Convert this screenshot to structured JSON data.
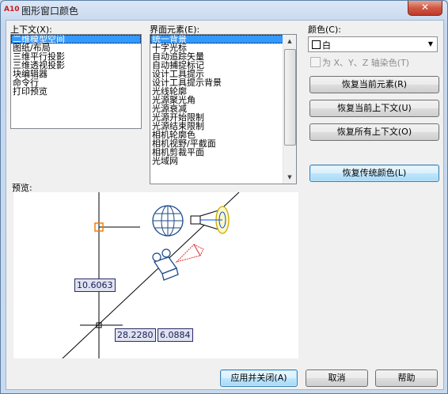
{
  "window": {
    "title": "图形窗口颜色",
    "app_icon": "A10",
    "close_glyph": "✕"
  },
  "context": {
    "label": "上下文(X):",
    "items": [
      "二维模型空间",
      "图纸/布局",
      "三维平行投影",
      "三维透视投影",
      "块编辑器",
      "命令行",
      "打印预览"
    ],
    "selected_index": 0
  },
  "elements": {
    "label": "界面元素(E):",
    "items": [
      "统一背景",
      "十字光标",
      "自动追踪矢量",
      "自动捕捉标记",
      "设计工具提示",
      "设计工具提示背景",
      "光线轮廓",
      "光源聚光角",
      "光源衰减",
      "光源开始限制",
      "光源结束限制",
      "相机轮廓色",
      "相机视野/平截面",
      "相机剪裁平面",
      "光域网"
    ],
    "selected_index": 0
  },
  "color": {
    "label": "颜色(C):",
    "value": "白",
    "tint_label": "为 X、Y、Z 轴染色(T)",
    "tint_checked": false
  },
  "buttons": {
    "restore_element": "恢复当前元素(R)",
    "restore_context": "恢复当前上下文(U)",
    "restore_all": "恢复所有上下文(O)",
    "restore_classic": "恢复传统颜色(L)",
    "apply_close": "应用并关闭(A)",
    "cancel": "取消",
    "help": "帮助"
  },
  "preview": {
    "label": "预览:",
    "dims": [
      "10.6063",
      "28.2280",
      "6.0884"
    ]
  },
  "colors": {
    "selection": "#3399ff",
    "titlebar": "#c9daef",
    "close_button": "#c0392b",
    "cursor_marker": "#f08000"
  }
}
